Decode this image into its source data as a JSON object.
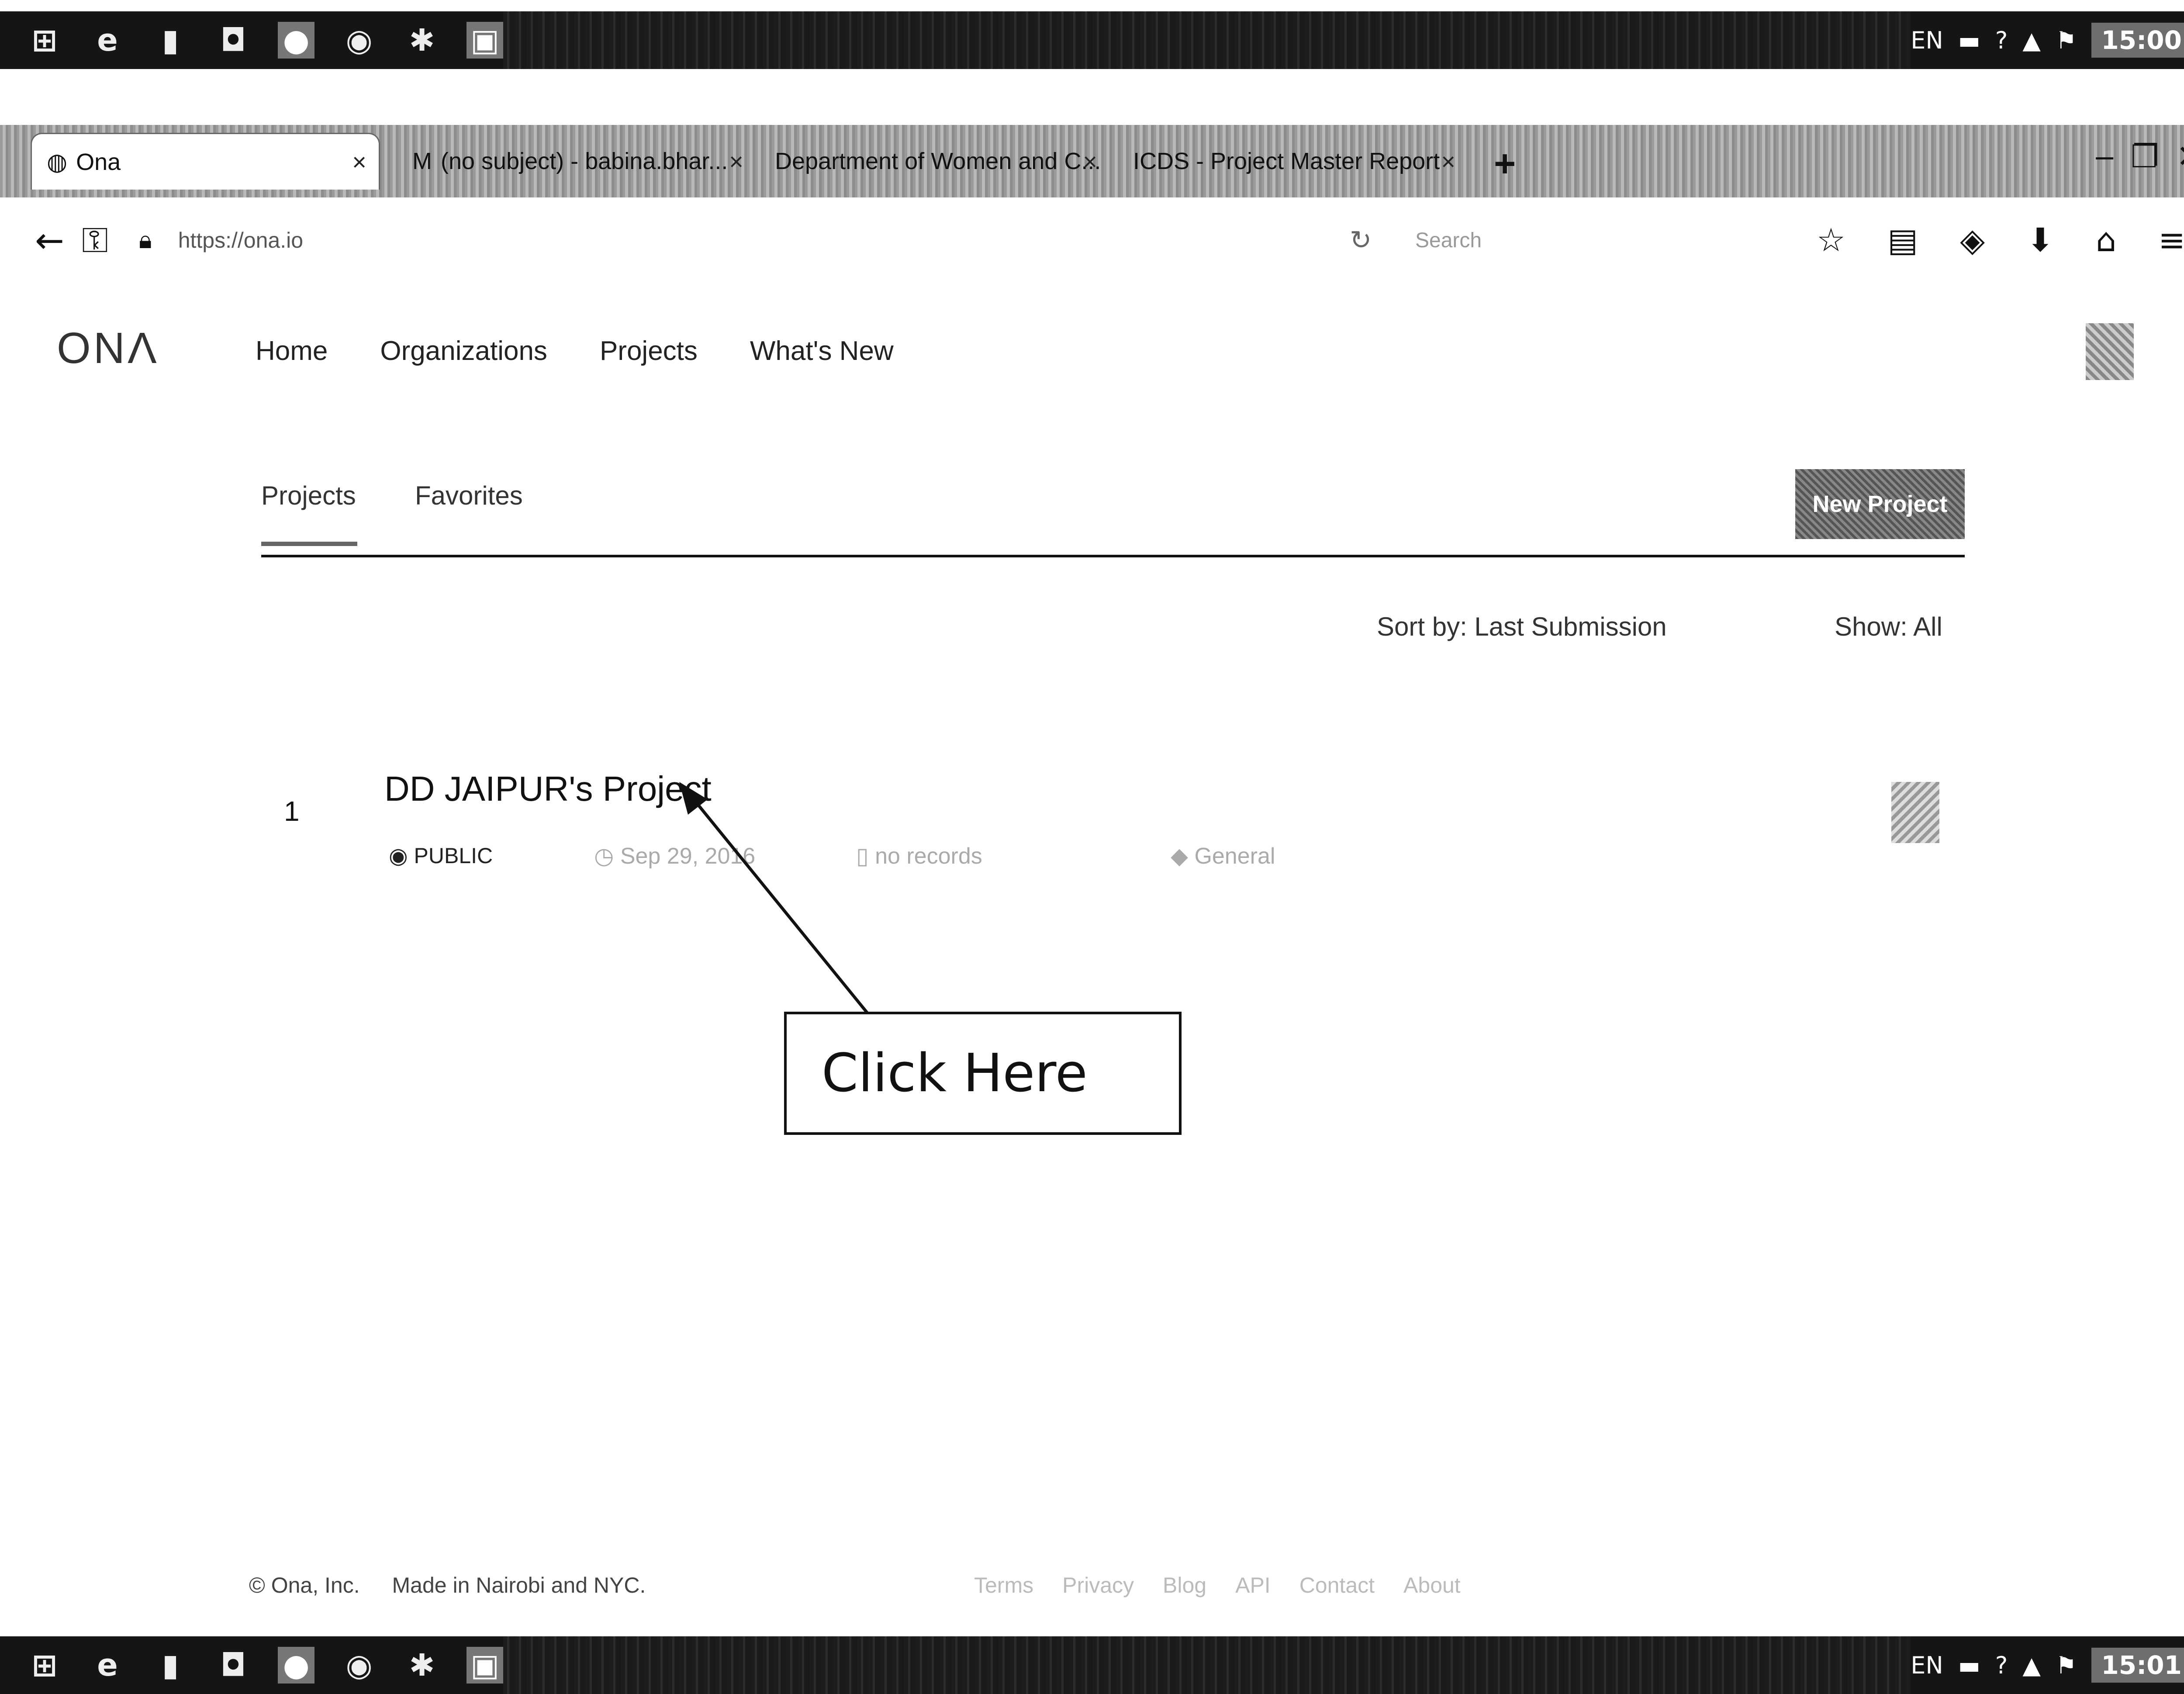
{
  "taskbar": {
    "icons": [
      "windows-start",
      "ie-browser",
      "file-explorer",
      "store",
      "firefox",
      "chrome",
      "settings",
      "app"
    ],
    "tray_lang": "EN",
    "clock_top": "15:00",
    "clock_bottom": "15:01"
  },
  "tabs": [
    {
      "label": "Ona",
      "active": true
    },
    {
      "label": "(no subject) - babina.bhar...",
      "active": false
    },
    {
      "label": "Department of Women and C...",
      "active": false
    },
    {
      "label": "ICDS - Project Master Report",
      "active": false
    }
  ],
  "address": {
    "url": "https://ona.io",
    "search_placeholder": "Search"
  },
  "site": {
    "logo": "ONΛ",
    "nav": [
      "Home",
      "Organizations",
      "Projects",
      "What's New"
    ]
  },
  "subnav": {
    "tabs": [
      "Projects",
      "Favorites"
    ],
    "new_project": "New Project"
  },
  "sort": {
    "sort_label": "Sort by: Last Submission",
    "show_label": "Show: All"
  },
  "project": {
    "index": "1",
    "title": "DD JAIPUR's Project",
    "visibility": "PUBLIC",
    "date": "Sep 29, 2016",
    "records": "no records",
    "category": "General"
  },
  "callout": "Click Here",
  "footer": {
    "copyright": "© Ona, Inc.",
    "made_in": "Made in Nairobi and NYC.",
    "links": [
      "Terms",
      "Privacy",
      "Blog",
      "API",
      "Contact",
      "About"
    ]
  }
}
